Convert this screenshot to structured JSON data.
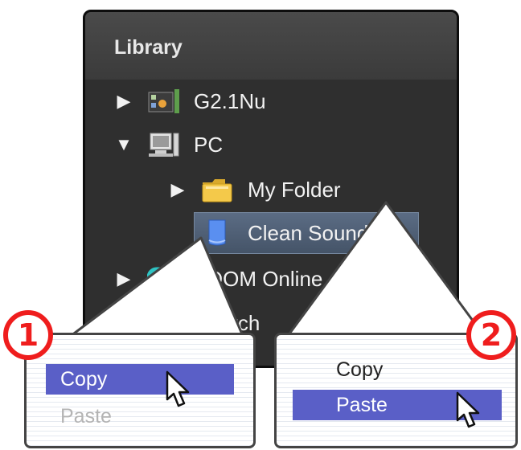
{
  "library": {
    "title": "Library",
    "items": [
      {
        "label": "G2.1Nu",
        "arrow": "▶",
        "icon": "multi-effects-device-icon"
      },
      {
        "label": "PC",
        "arrow": "▼",
        "icon": "computer-icon"
      },
      {
        "label": "My Folder",
        "arrow": "▶",
        "icon": "folder-icon"
      },
      {
        "label": "Clean Sound",
        "arrow": "",
        "icon": "patch-file-icon",
        "selected": true
      },
      {
        "label": "ZOOM Online",
        "arrow": "▶",
        "icon": "zoom-online-icon"
      },
      {
        "label": "Search",
        "arrow": "▶",
        "icon": "search-icon"
      }
    ]
  },
  "callouts": [
    {
      "step": "1",
      "menu": [
        {
          "label": "Copy",
          "state": "highlighted"
        },
        {
          "label": "Paste",
          "state": "disabled"
        }
      ]
    },
    {
      "step": "2",
      "menu": [
        {
          "label": "Copy",
          "state": "normal"
        },
        {
          "label": "Paste",
          "state": "highlighted"
        }
      ]
    }
  ],
  "colors": {
    "panel": "#2f2f2f",
    "selection": "#4c5c74",
    "menu_highlight": "#5a5fc7",
    "badge": "#ef1d1d"
  }
}
